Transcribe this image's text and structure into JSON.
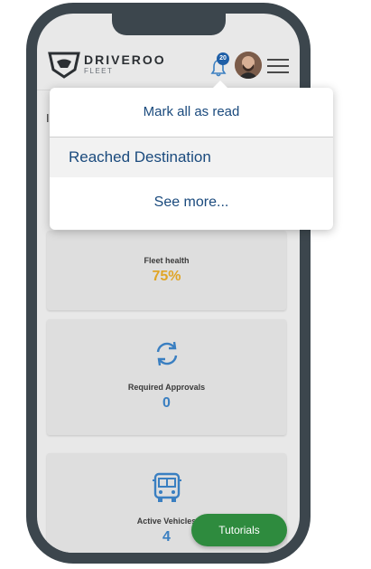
{
  "header": {
    "brand": "DRIVEROO",
    "brand_sub": "FLEET",
    "notification_count": "20",
    "avatar_icon": "user-avatar",
    "menu_icon": "hamburger-icon"
  },
  "background": {
    "peek_letter": "I"
  },
  "cards": [
    {
      "label": "Fleet health",
      "value": "75%",
      "value_color": "#e0a526"
    },
    {
      "label": "Required Approvals",
      "value": "0",
      "value_color": "#3a7fc1",
      "icon": "refresh-icon"
    },
    {
      "label": "Active Vehicles",
      "value": "4",
      "value_color": "#3a7fc1",
      "icon": "bus-icon"
    }
  ],
  "notifications": {
    "mark_all_label": "Mark all as read",
    "items": [
      "Reached Destination"
    ],
    "see_more_label": "See more..."
  },
  "tutorials_label": "Tutorials",
  "colors": {
    "primary_blue": "#1a4a7d",
    "accent_blue": "#3a7fc1",
    "warning_yellow": "#e0a526",
    "tutorials_green": "#2e8b3e",
    "frame": "#3c464d"
  }
}
